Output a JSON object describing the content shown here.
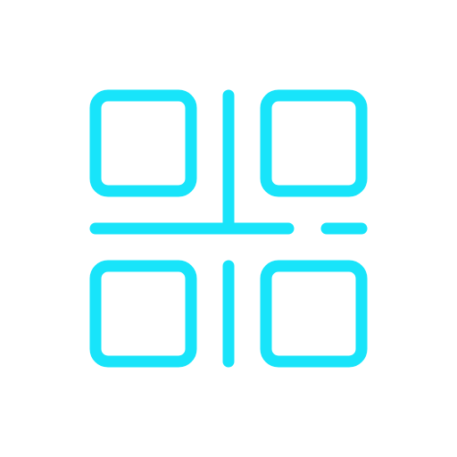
{
  "icon": {
    "name": "qr-code-scan-icon",
    "color": "#18E4FA",
    "background": "#FFFFFF"
  }
}
